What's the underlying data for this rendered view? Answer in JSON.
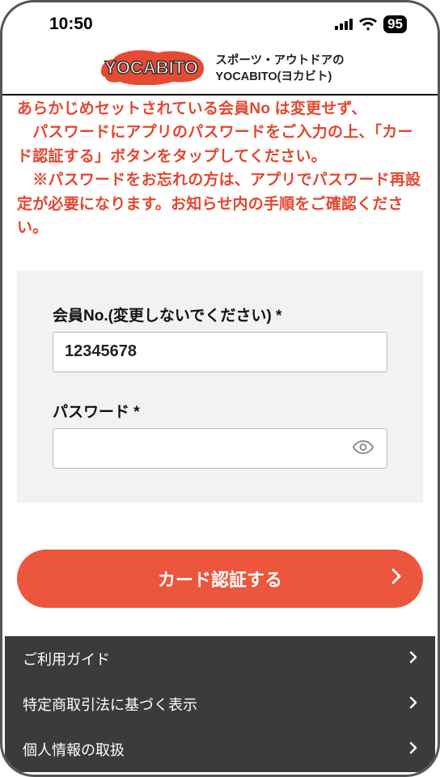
{
  "status": {
    "time": "10:50",
    "battery": "95"
  },
  "header": {
    "logo_text": "YOCABITO",
    "tag_line1": "スポーツ・アウトドアの",
    "tag_line2": "YOCABITO(ヨカビト)"
  },
  "notice": {
    "line1": "あらかじめセットされている会員No は変更せず、",
    "line2": "　パスワードにアプリのパスワードをご入力の上、「カード認証する」ボタンをタップしてください。",
    "line3": "　※パスワードをお忘れの方は、アプリでパスワード再設定が必要になります。お知らせ内の手順をご確認ください。"
  },
  "form": {
    "member_label": "会員No.(変更しないでください) *",
    "member_value": "12345678",
    "password_label": "パスワード *",
    "password_value": ""
  },
  "submit_label": "カード認証する",
  "footer": {
    "items": [
      {
        "label": "ご利用ガイド"
      },
      {
        "label": "特定商取引法に基づく表示"
      },
      {
        "label": "個人情報の取扱"
      }
    ]
  }
}
